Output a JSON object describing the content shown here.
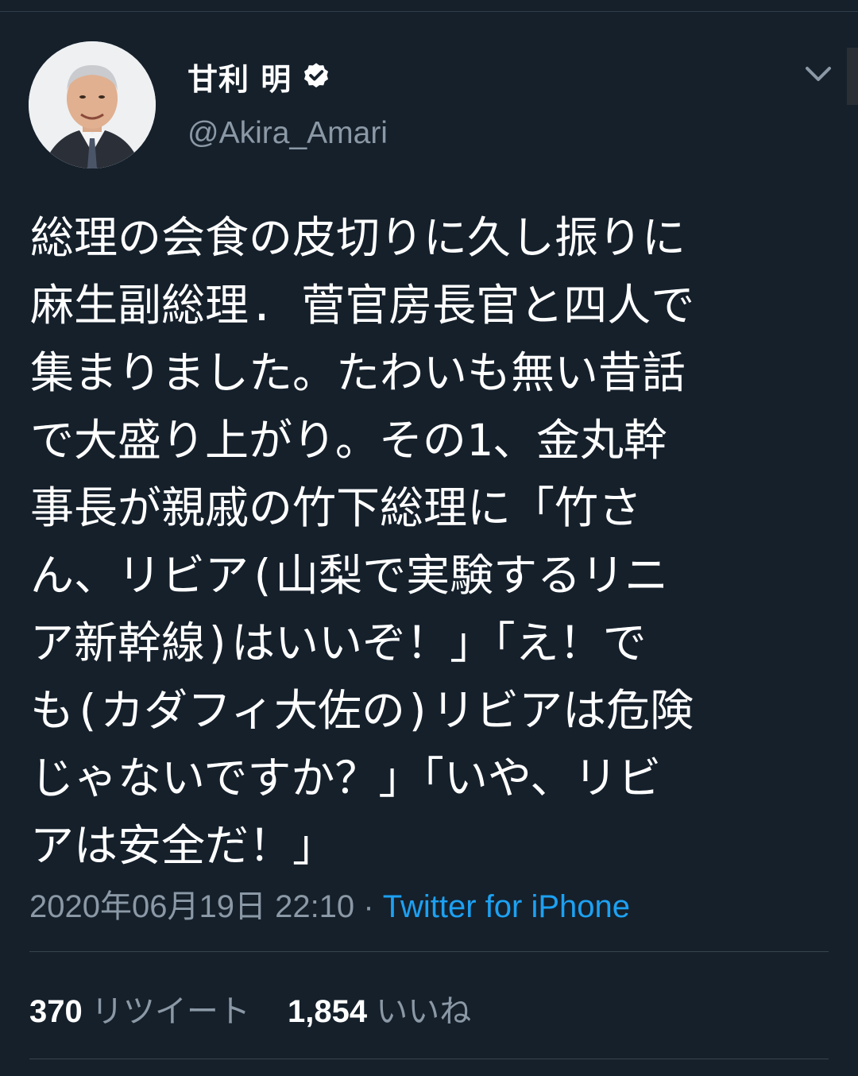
{
  "colors": {
    "background": "#15202b",
    "primary_text": "#ffffff",
    "secondary_text": "#8b98a5",
    "link": "#1da1f2",
    "divider": "#38444d"
  },
  "author": {
    "display_name": "甘利 明",
    "handle": "@Akira_Amari",
    "verified": true,
    "avatar_icon": "profile-photo"
  },
  "tweet": {
    "text": "総理の会食の皮切りに久し振りに\n麻生副総理. 菅官房長官と四人で\n集まりました。たわいも無い昔話\nで大盛り上がり。その1、金丸幹\n事長が親戚の竹下総理に「竹さ\nん、リビア(山梨で実験するリニ\nア新幹線)はいいぞ！」「え！で\nも(カダフィ大佐の)リビアは危険\nじゃないですか？」「いや、リビ\nアは安全だ！」",
    "timestamp": "2020年06月19日 22:10",
    "separator": "·",
    "source": "Twitter for iPhone"
  },
  "stats": {
    "retweets_count": "370",
    "retweets_label": "リツイート",
    "likes_count": "1,854",
    "likes_label": "いいね"
  },
  "icons": {
    "verified": "verified-badge-icon",
    "more": "chevron-down-icon"
  }
}
